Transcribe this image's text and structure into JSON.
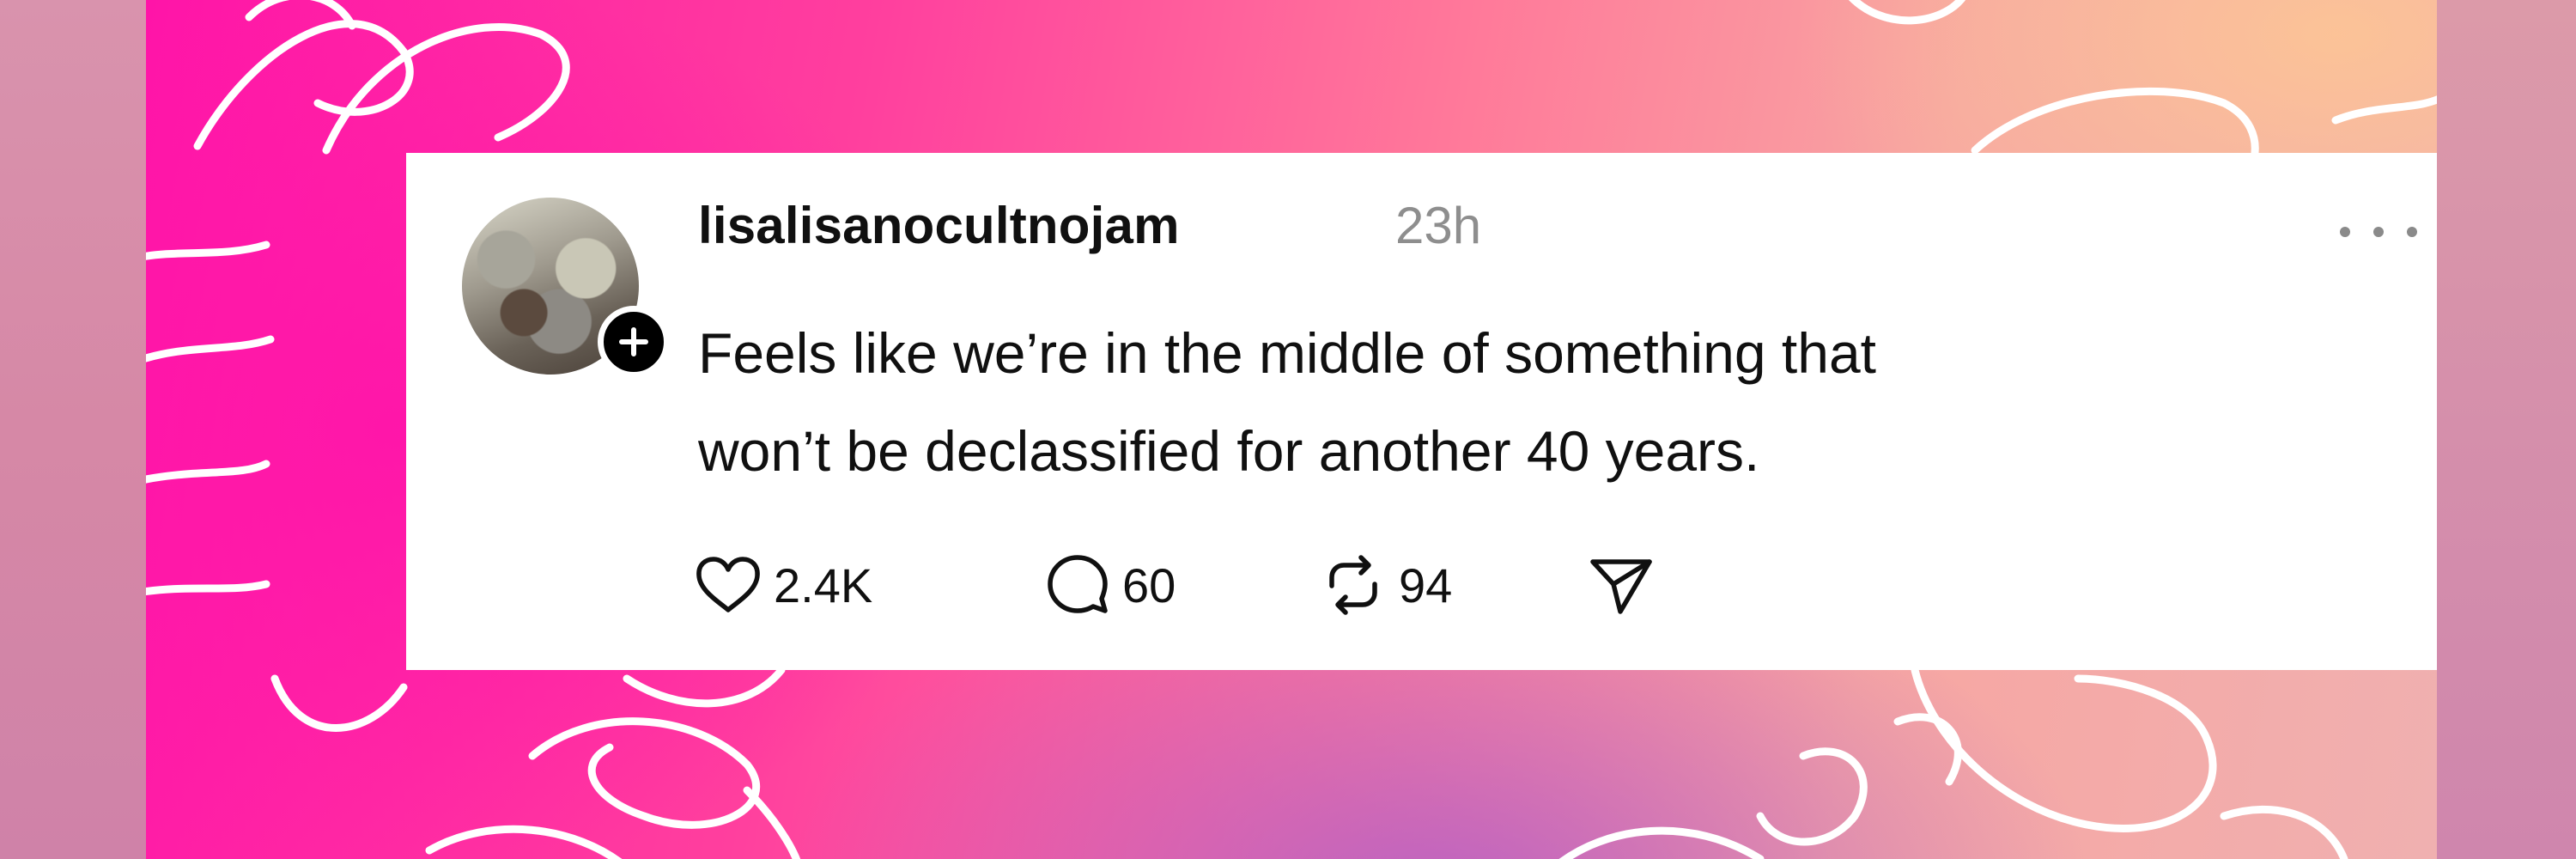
{
  "post": {
    "username": "lisalisanocultnojam",
    "timestamp": "23h",
    "text_line1": "Feels like we’re in the middle of something that",
    "text_line2": "won’t be declassified for another 40 years."
  },
  "actions": {
    "likes": "2.4K",
    "comments": "60",
    "reposts": "94"
  },
  "icons": {
    "like": "heart-icon",
    "comment": "comment-bubble-icon",
    "repost": "repost-icon",
    "share": "send-icon",
    "more": "more-dots-icon",
    "follow": "plus-icon"
  },
  "colors": {
    "text": "#101010",
    "muted": "#8e8e8e",
    "card": "#ffffff",
    "background_pink": "#ff14a8",
    "background_peach": "#fcc496"
  }
}
